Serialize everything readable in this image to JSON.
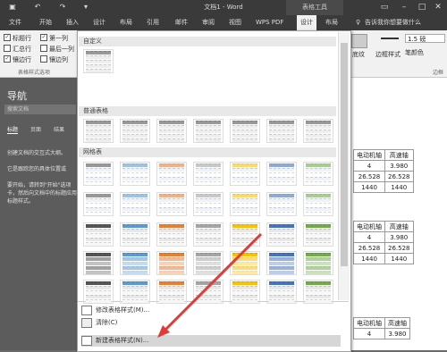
{
  "window": {
    "title": "文档1 - Word",
    "context_label": "表格工具"
  },
  "ribbon_tabs": [
    "文件",
    "开始",
    "插入",
    "设计",
    "布局",
    "引用",
    "邮件",
    "审阅",
    "视图",
    "WPS PDF",
    "设计",
    "布局"
  ],
  "search_hint": "告诉我你想要做什么",
  "style_options": {
    "items": [
      {
        "label": "标题行",
        "checked": true
      },
      {
        "label": "第一列",
        "checked": true
      },
      {
        "label": "汇总行",
        "checked": false
      },
      {
        "label": "最后一列",
        "checked": false
      },
      {
        "label": "镶边行",
        "checked": true
      },
      {
        "label": "镶边列",
        "checked": false
      }
    ],
    "group_label": "表格样式选项"
  },
  "ribbon_right": {
    "shading": "底纹",
    "border_styles": "边框样式",
    "line_width": "1.5 磅",
    "pen_color": "笔颜色",
    "borders_group": "边框"
  },
  "nav": {
    "title": "导航",
    "search_placeholder": "搜索文档",
    "tabs": [
      "标题",
      "页面",
      "结果"
    ],
    "p1": "创建文档的交互式大纲。",
    "p2": "它是跟踪您的具体位置或",
    "p3": "要开始，请转到\"开始\"选项卡，然后向文档中的标题应用标题样式。"
  },
  "gallery": {
    "section_custom": "自定义",
    "section_plain": "普通表格",
    "section_grid": "网格表",
    "menu": [
      {
        "label": "修改表格样式(M)..."
      },
      {
        "label": "清除(C)"
      },
      {
        "label": "新建表格样式(N)..."
      }
    ]
  },
  "document": {
    "table_a": [
      [
        "电动机轴",
        "高速轴"
      ],
      [
        "4",
        "3.980"
      ],
      [
        "26.528",
        "26.528"
      ],
      [
        "1440",
        "1440"
      ]
    ],
    "table_b": [
      [
        "电动机轴",
        "高速轴"
      ],
      [
        "4",
        "3.980"
      ],
      [
        "26.528",
        "26.528"
      ],
      [
        "1440",
        "1440"
      ]
    ],
    "table_c": [
      [
        "电动机轴",
        "高速轴"
      ],
      [
        "4",
        "3.980"
      ]
    ]
  },
  "colors": {
    "accent_arrow": "#e53935",
    "ribbon_dark": "#3a3a3a"
  }
}
